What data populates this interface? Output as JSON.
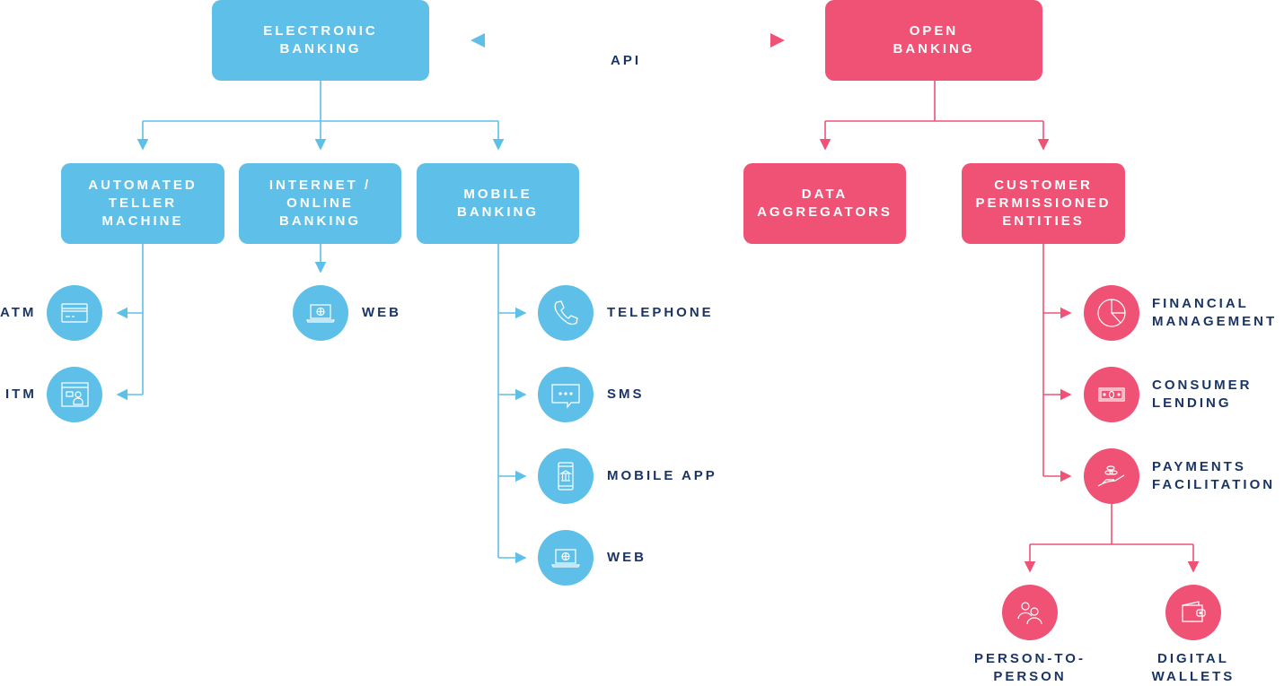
{
  "colors": {
    "electronic": "#5ec0e8",
    "open": "#f05275",
    "text": "#1a3564"
  },
  "api_label": "API",
  "electronic_banking": {
    "title": [
      "ELECTRONIC",
      "BANKING"
    ],
    "children": [
      {
        "title": [
          "AUTOMATED",
          "TELLER",
          "MACHINE"
        ],
        "items": [
          {
            "label": "ATM",
            "icon": "credit-card-icon"
          },
          {
            "label": "ITM",
            "icon": "video-teller-icon"
          }
        ]
      },
      {
        "title": [
          "INTERNET /",
          "ONLINE",
          "BANKING"
        ],
        "items": [
          {
            "label": "WEB",
            "icon": "laptop-globe-icon"
          }
        ]
      },
      {
        "title": [
          "MOBILE",
          "BANKING"
        ],
        "items": [
          {
            "label": "TELEPHONE",
            "icon": "telephone-icon"
          },
          {
            "label": "SMS",
            "icon": "chat-bubble-icon"
          },
          {
            "label": "MOBILE APP",
            "icon": "mobile-bank-icon"
          },
          {
            "label": "WEB",
            "icon": "laptop-globe-icon"
          }
        ]
      }
    ]
  },
  "open_banking": {
    "title": [
      "OPEN",
      "BANKING"
    ],
    "children": [
      {
        "title": [
          "DATA",
          "AGGREGATORS"
        ]
      },
      {
        "title": [
          "CUSTOMER",
          "PERMISSIONED",
          "ENTITIES"
        ],
        "items": [
          {
            "label": [
              "FINANCIAL",
              "MANAGEMENT"
            ],
            "icon": "pie-chart-icon"
          },
          {
            "label": [
              "CONSUMER",
              "LENDING"
            ],
            "icon": "banknote-icon"
          },
          {
            "label": [
              "PAYMENTS",
              "FACILITATION"
            ],
            "icon": "hand-coins-icon",
            "children": [
              {
                "label": [
                  "PERSON-TO-",
                  "PERSON"
                ],
                "icon": "people-icon"
              },
              {
                "label": [
                  "DIGITAL",
                  "WALLETS"
                ],
                "icon": "wallet-icon"
              }
            ]
          }
        ]
      }
    ]
  }
}
